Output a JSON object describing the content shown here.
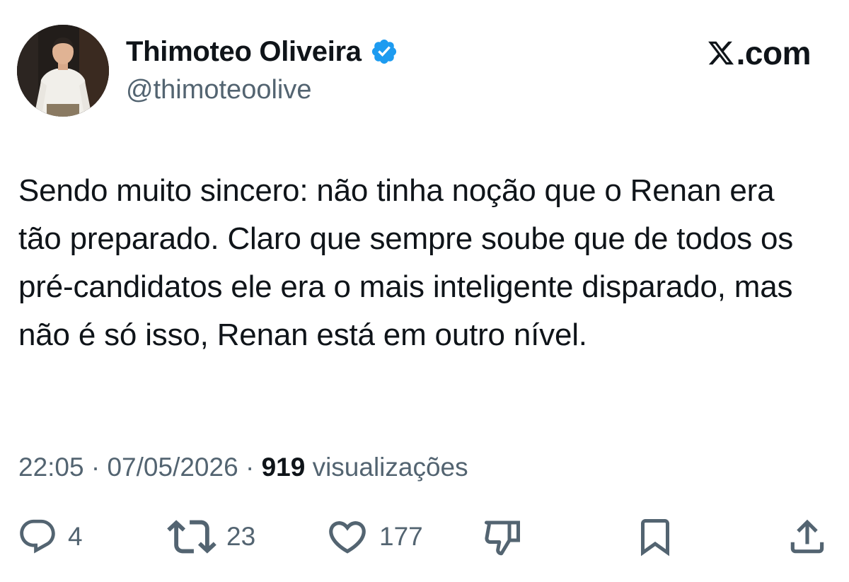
{
  "author": {
    "display_name": "Thimoteo Oliveira",
    "handle": "@thimoteoolive",
    "verified": true
  },
  "brand": {
    "text": ".com",
    "icon": "x-logo-icon"
  },
  "tweet": {
    "text": "Sendo muito sincero: não tinha noção que o Renan era tão preparado. Claro que sempre soube que de todos os pré-candidatos ele era o mais inteligente disparado, mas não é só isso, Renan está em outro nível."
  },
  "meta": {
    "time": "22:05",
    "separator": "·",
    "date": "07/05/2026",
    "views_count": "919",
    "views_label": "visualizações"
  },
  "actions": {
    "reply": {
      "icon": "reply-icon",
      "count": "4"
    },
    "retweet": {
      "icon": "retweet-icon",
      "count": "23"
    },
    "like": {
      "icon": "heart-icon",
      "count": "177"
    },
    "dislike": {
      "icon": "thumbs-down-icon"
    },
    "bookmark": {
      "icon": "bookmark-icon"
    },
    "share": {
      "icon": "share-icon"
    }
  },
  "colors": {
    "text": "#0f1419",
    "secondary": "#536471",
    "verified": "#1d9bf0",
    "background": "#ffffff"
  }
}
